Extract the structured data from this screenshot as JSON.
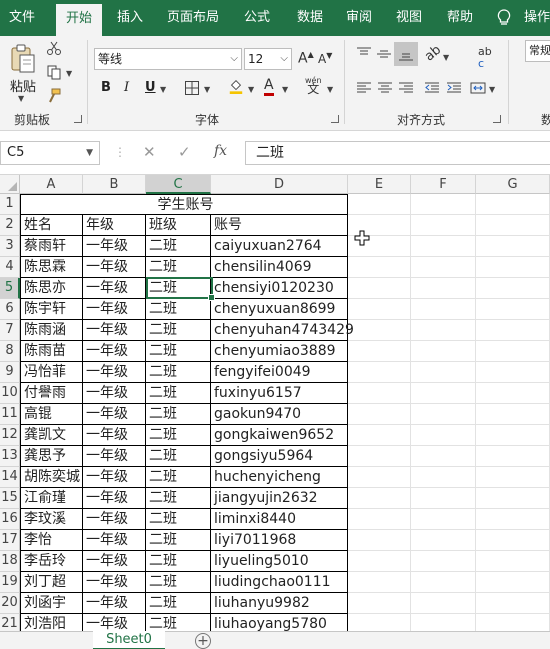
{
  "tabs": [
    "文件",
    "开始",
    "插入",
    "页面布局",
    "公式",
    "数据",
    "审阅",
    "视图",
    "帮助",
    "操作"
  ],
  "ribbon": {
    "paste_label": "粘贴",
    "clipboard_label": "剪贴板",
    "font_name": "等线",
    "font_size": "12",
    "font_group_label": "字体",
    "align_group_label": "对齐方式",
    "number_format": "常规",
    "number_group_label": "数",
    "bold": "B",
    "italic": "I",
    "underline": "U",
    "wen": "wén",
    "wen_char": "文",
    "wrap_label": "ab",
    "wrap_sub": "c",
    "fx": "fx"
  },
  "formula_bar": {
    "name_box": "C5",
    "value": "二班"
  },
  "columns": [
    "A",
    "B",
    "C",
    "D",
    "E",
    "F",
    "G"
  ],
  "title": "学生账号",
  "headers": [
    "姓名",
    "年级",
    "班级",
    "账号"
  ],
  "rows": [
    [
      "蔡雨轩",
      "一年级",
      "二班",
      "caiyuxuan2764"
    ],
    [
      "陈思霖",
      "一年级",
      "二班",
      "chensilin4069"
    ],
    [
      "陈思亦",
      "一年级",
      "二班",
      "chensiyi0120230"
    ],
    [
      "陈宇轩",
      "一年级",
      "二班",
      "chenyuxuan8699"
    ],
    [
      "陈雨涵",
      "一年级",
      "二班",
      "chenyuhan4743429"
    ],
    [
      "陈雨苗",
      "一年级",
      "二班",
      "chenyumiao3889"
    ],
    [
      "冯怡菲",
      "一年级",
      "二班",
      "fengyifei0049"
    ],
    [
      "付譽雨",
      "一年级",
      "二班",
      "fuxinyu6157"
    ],
    [
      "高锟",
      "一年级",
      "二班",
      "gaokun9470"
    ],
    [
      "龚凯文",
      "一年级",
      "二班",
      "gongkaiwen9652"
    ],
    [
      "龚思予",
      "一年级",
      "二班",
      "gongsiyu5964"
    ],
    [
      "胡陈奕城",
      "一年级",
      "二班",
      "huchenyicheng"
    ],
    [
      "江俞瑾",
      "一年级",
      "二班",
      "jiangyujin2632"
    ],
    [
      "李玟溪",
      "一年级",
      "二班",
      "liminxi8440"
    ],
    [
      "李怡",
      "一年级",
      "二班",
      "liyi7011968"
    ],
    [
      "李岳玲",
      "一年级",
      "二班",
      "liyueling5010"
    ],
    [
      "刘丁超",
      "一年级",
      "二班",
      "liudingchao0111"
    ],
    [
      "刘函宇",
      "一年级",
      "二班",
      "liuhanyu9982"
    ],
    [
      "刘浩阳",
      "一年级",
      "二班",
      "liuhaoyang5780"
    ]
  ],
  "row_numbers": [
    "1",
    "2",
    "3",
    "4",
    "5",
    "6",
    "7",
    "8",
    "9",
    "10",
    "11",
    "12",
    "13",
    "14",
    "15",
    "16",
    "17",
    "18",
    "19",
    "20",
    "21"
  ],
  "sheet": {
    "tab_name": "Sheet0",
    "add": "+"
  },
  "colors": {
    "accent": "#217346"
  }
}
